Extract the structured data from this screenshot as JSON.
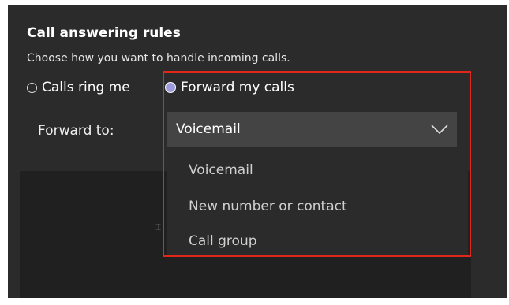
{
  "title": "Call answering rules",
  "subtitle": "Choose how you want to handle incoming calls.",
  "radios": [
    {
      "label": "Calls ring me",
      "selected": false
    },
    {
      "label": "Forward my calls",
      "selected": true
    }
  ],
  "forward_label": "Forward to:",
  "select": {
    "value": "Voicemail",
    "icon": "chevron-down-icon"
  },
  "dropdown": {
    "options": [
      "Voicemail",
      "New number or contact",
      "Call group"
    ]
  },
  "colors": {
    "panel_bg": "#2b2b2b",
    "select_bg": "#444444",
    "selected_radio_fill": "#9c9cdc",
    "highlight_border": "#e0271a"
  }
}
